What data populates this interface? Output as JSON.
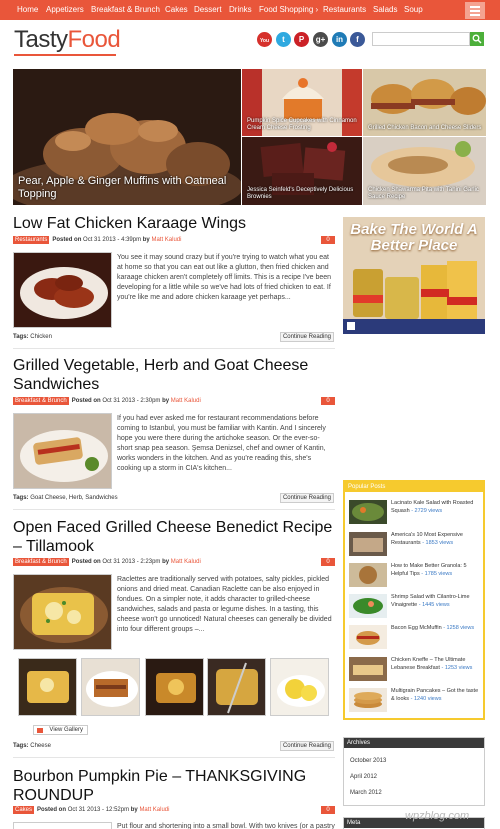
{
  "nav": {
    "items": [
      "Home",
      "Appetizers",
      "Breakfast & Brunch",
      "Cakes",
      "Dessert",
      "Drinks",
      "Food Shopping",
      "Restaurants",
      "Salads",
      "Soup"
    ]
  },
  "logo": {
    "part1": "Tasty",
    "part2": "Food"
  },
  "social": [
    {
      "icon": "youtube-icon",
      "glyph": "You",
      "color": "#d6312c"
    },
    {
      "icon": "twitter-icon",
      "glyph": "t",
      "color": "#2fa9e0"
    },
    {
      "icon": "pinterest-icon",
      "glyph": "P",
      "color": "#cb2127"
    },
    {
      "icon": "googleplus-icon",
      "glyph": "g+",
      "color": "#4b4b4b"
    },
    {
      "icon": "linkedin-icon",
      "glyph": "in",
      "color": "#1f7bb6"
    },
    {
      "icon": "facebook-icon",
      "glyph": "f",
      "color": "#3b5998"
    }
  ],
  "featured": {
    "main": "Pear, Apple & Ginger Muffins with Oatmeal Topping",
    "s1": "Pumpkin Spice Cupcakes with Cinnamon Cream Cheese Frosting",
    "s2": "Grilled Chicken Bacon and Cheese Sliders",
    "s3": "Jessica Seinfeld's Deceptively Delicious Brownies",
    "s4": "Chicken Shawarma Pita with Tahini Garlic Sauce Recipe"
  },
  "posts": [
    {
      "title": "Low Fat Chicken Karaage Wings",
      "category": "Restaurants",
      "posted": "Posted on",
      "date": "Oct 31 2013 - 4:39pm",
      "by": "by",
      "author": "Matt Kaludi",
      "comments": "0",
      "excerpt": "You see it may sound crazy but if you're trying to watch what you eat at home so that you can eat out like a glutton, then fried chicken and karaage chicken aren't completely off limits. This is a recipe I've been developing for a little while so we've had lots of fried chicken to eat. If you're like me and adore chicken karaage yet perhaps...",
      "tags_label": "Tags:",
      "tags": "Chicken",
      "more": "Continue Reading"
    },
    {
      "title": "Grilled Vegetable, Herb and Goat Cheese Sandwiches",
      "category": "Breakfast & Brunch",
      "posted": "Posted on",
      "date": "Oct 31 2013 - 2:30pm",
      "by": "by",
      "author": "Matt Kaludi",
      "comments": "0",
      "excerpt": "If you had ever asked me for restaurant recommendations before coming to Istanbul, you must be familiar with Kantin. And I sincerely hope you were there during the artichoke season. Or the ever-so-short snap pea season. Şemsa Denizsel, chef and owner of Kantin, works wonders in the kitchen. And as you're reading this, she's cooking up a storm in CIA's kitchen...",
      "tags_label": "Tags:",
      "tags": "Goat Cheese, Herb, Sandwiches",
      "more": "Continue Reading"
    },
    {
      "title": "Open Faced Grilled Cheese Benedict Recipe – Tillamook",
      "category": "Breakfast & Brunch",
      "posted": "Posted on",
      "date": "Oct 31 2013 - 2:23pm",
      "by": "by",
      "author": "Matt Kaludi",
      "comments": "0",
      "excerpt": "Raclettes are traditionally served with potatoes, salty pickles, pickled onions and dried meat. Canadian Raclette can be also enjoyed in fondues. On a simpler note, it adds character to grilled-cheese sandwiches, salads and pasta or legume dishes. In a tasting, this cheese won't go unnoticed! Natural cheeses can generally be divided into four different groups –...",
      "tags_label": "Tags:",
      "tags": "Cheese",
      "more": "Continue Reading",
      "gallery": "View Gallery"
    },
    {
      "title": "Bourbon Pumpkin Pie – THANKSGIVING ROUNDUP",
      "category": "Cakes",
      "posted": "Posted on",
      "date": "Oct 31 2013 - 12:52pm",
      "by": "by",
      "author": "Matt Kaludi",
      "comments": "0",
      "excerpt": "Put flour and shortening into a small bowl. With two knives (or a pastry"
    }
  ],
  "ad": {
    "headline": "Bake The World A Better Place"
  },
  "popular": {
    "heading": "Popular Posts",
    "items": [
      {
        "title": "Lacinato Kale Salad with Roasted Squash",
        "views": "- 2729 views"
      },
      {
        "title": "America's 10 Most Expensive Restaurants",
        "views": "- 1853 views"
      },
      {
        "title": "How to Make Better Granola: 5 Helpful Tips",
        "views": "- 1785 views"
      },
      {
        "title": "Shrimp Salad with Cilantro-Lime Vinaigrette",
        "views": "- 1445 views"
      },
      {
        "title": "Bacon Egg McMuffin",
        "views": "- 1258 views"
      },
      {
        "title": "Chicken Kneffe – The Ultimate Lebanese Breakfast",
        "views": "- 1253 views"
      },
      {
        "title": "Multigrain Pancakes – Got the taste & looks",
        "views": "- 1240 views"
      }
    ]
  },
  "archives": {
    "heading": "Archives",
    "items": [
      "October 2013",
      "April 2012",
      "March 2012"
    ]
  },
  "meta_widget": {
    "heading": "Meta"
  },
  "watermark": "wpzblog.com"
}
